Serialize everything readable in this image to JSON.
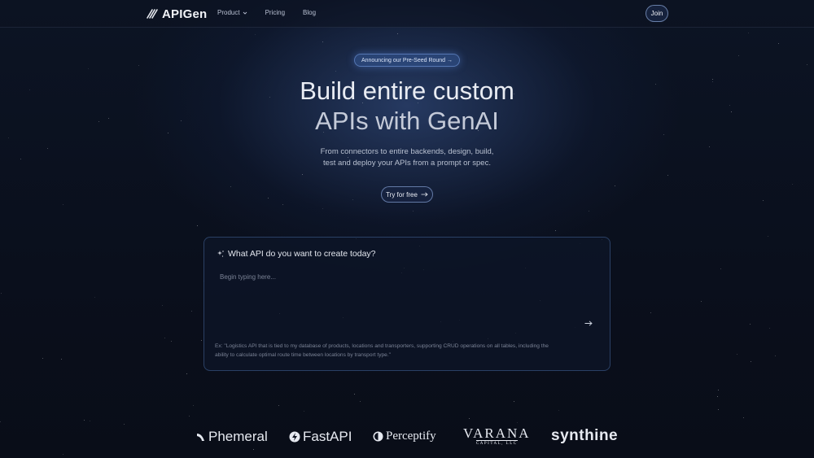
{
  "nav": {
    "brand": "APIGen",
    "links": [
      {
        "label": "Product",
        "has_dropdown": true
      },
      {
        "label": "Pricing"
      },
      {
        "label": "Blog"
      }
    ],
    "join_label": "Join"
  },
  "hero": {
    "announcement": "Announcing our Pre-Seed Round →",
    "title_line1": "Build entire custom",
    "title_line2": "APIs with GenAI",
    "subtitle_line1": "From connectors to entire backends, design, build,",
    "subtitle_line2": "test and deploy your APIs from a prompt or spec.",
    "cta_label": "Try for free"
  },
  "prompt": {
    "title": "What API do you want to create today?",
    "placeholder": "Begin typing here...",
    "value": "",
    "example_line1": "Ex: \"Logistics API that is tied to my database of products, locations and transporters, supporting CRUD operations on all tables, including the",
    "example_line2": "ability to calculate optimal route time between locations by transport type.\""
  },
  "partners": {
    "phemeral": "Phemeral",
    "fastapi": "FastAPI",
    "perceptify": "Perceptify",
    "varana": "VARANA",
    "varana_sub": "CAPITAL, LLC",
    "synthine": "synthine"
  },
  "colors": {
    "background": "#0a0f1c",
    "accent": "#3c64aa",
    "text": "#e6e9f0"
  }
}
